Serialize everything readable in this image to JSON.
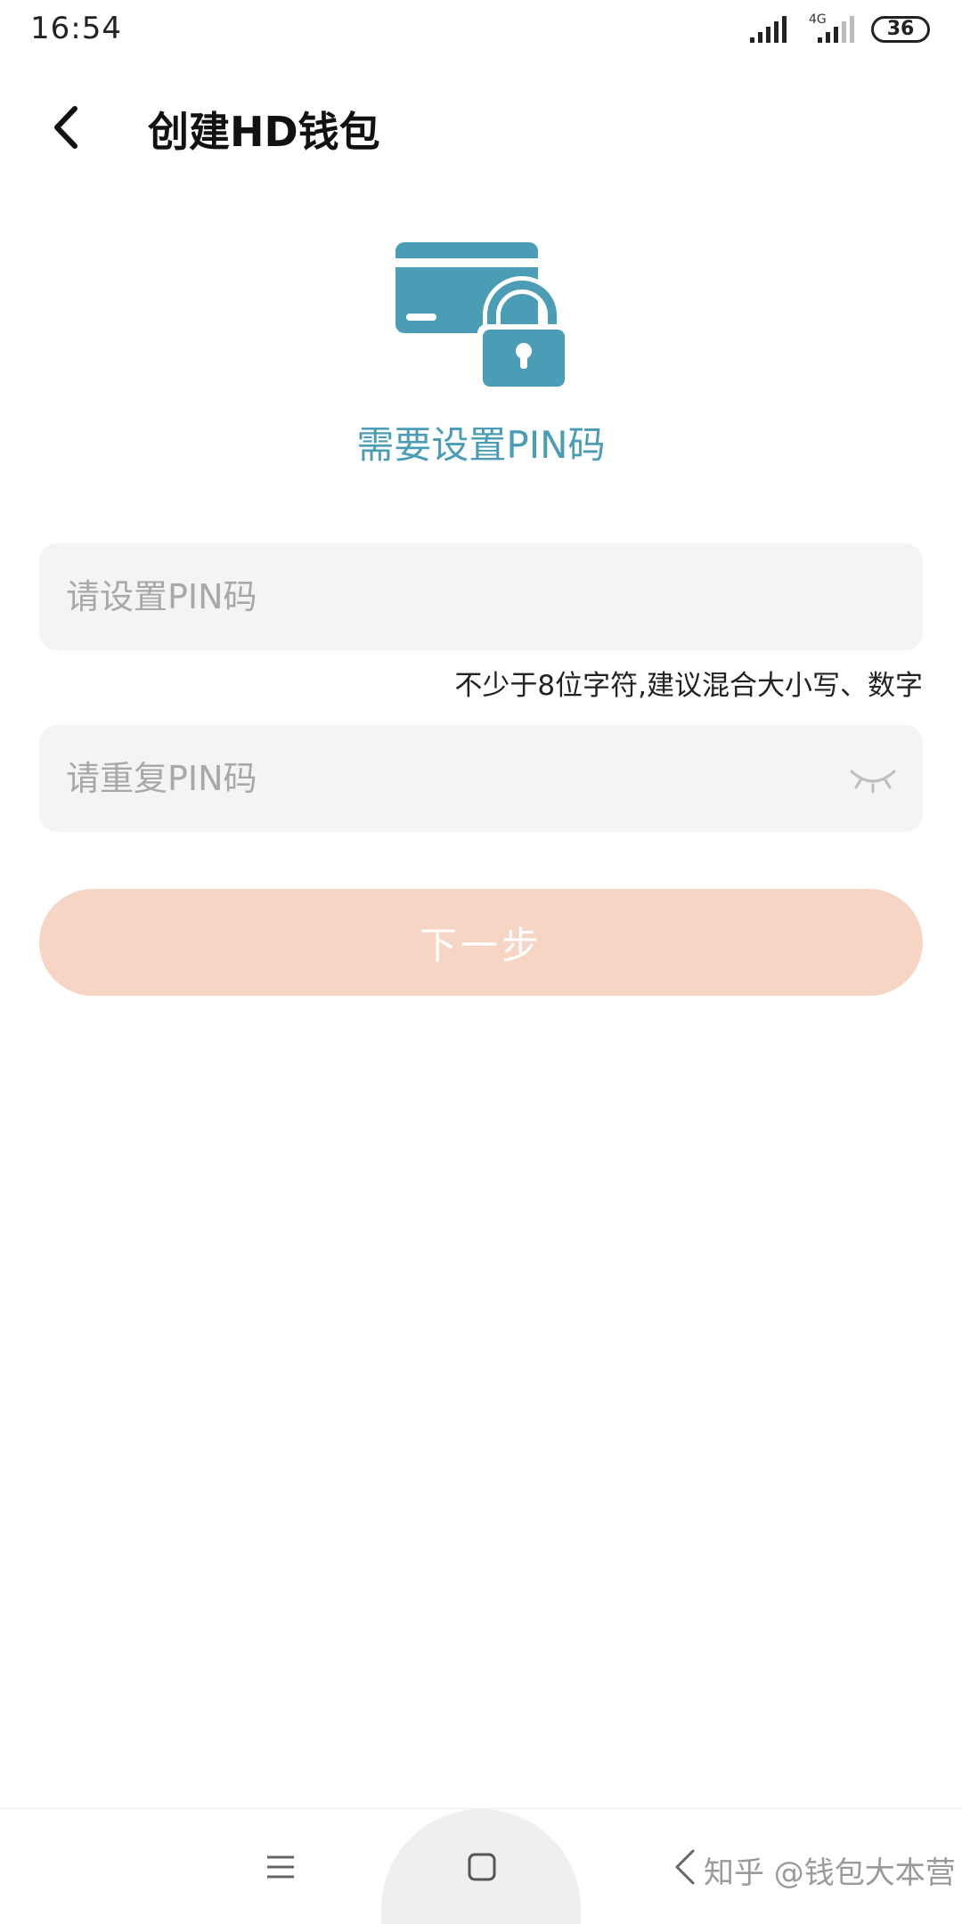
{
  "status_bar": {
    "time": "16:54",
    "network": "4G",
    "battery": "36"
  },
  "header": {
    "title": "创建HD钱包",
    "back_icon": "chevron-left-icon"
  },
  "illustration": {
    "icon": "card-lock-icon",
    "color": "#4a9db4"
  },
  "heading": "需要设置PIN码",
  "form": {
    "pin_placeholder": "请设置PIN码",
    "pin_value": "",
    "pin_hint": "不少于8位字符,建议混合大小写、数字",
    "repeat_placeholder": "请重复PIN码",
    "repeat_value": "",
    "visibility_icon": "eye-closed-icon"
  },
  "next_button": {
    "label": "下一步",
    "color": "#f7d5c5"
  },
  "nav_bar": {
    "menu_icon": "menu-icon",
    "home_icon": "home-icon",
    "back_icon": "back-icon"
  },
  "watermark": "知乎 @钱包大本营"
}
